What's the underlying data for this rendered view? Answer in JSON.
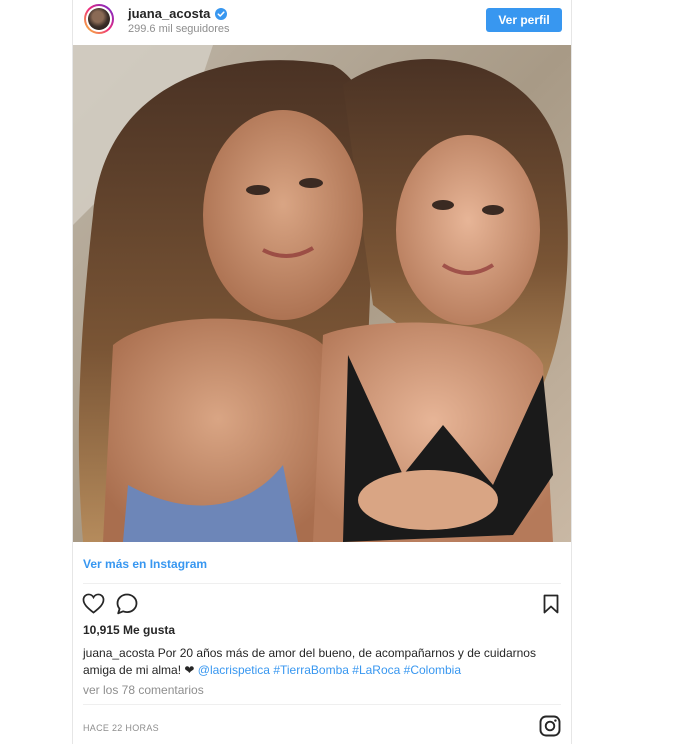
{
  "header": {
    "username": "juana_acosta",
    "followers": "299.6 mil seguidores",
    "profile_button": "Ver perfil"
  },
  "post": {
    "view_more": "Ver más en Instagram",
    "likes": "10,915 Me gusta",
    "caption_user": "juana_acosta",
    "caption_text": " Por 20 años más de amor del bueno, de acompañarnos y de cuidarnos amiga de mi alma! ❤ ",
    "caption_mention": "@lacrispetica",
    "caption_tags": [
      "#TierraBomba",
      "#LaRoca",
      "#Colombia"
    ],
    "comments": "ver los 78 comentarios",
    "time": "HACE 22 HORAS"
  },
  "icons": [
    "verified-badge-icon",
    "heart-icon",
    "comment-icon",
    "bookmark-icon",
    "instagram-logo-icon"
  ],
  "colors": {
    "accent": "#3897f0",
    "text": "#262626",
    "muted": "#8e8e8e"
  }
}
